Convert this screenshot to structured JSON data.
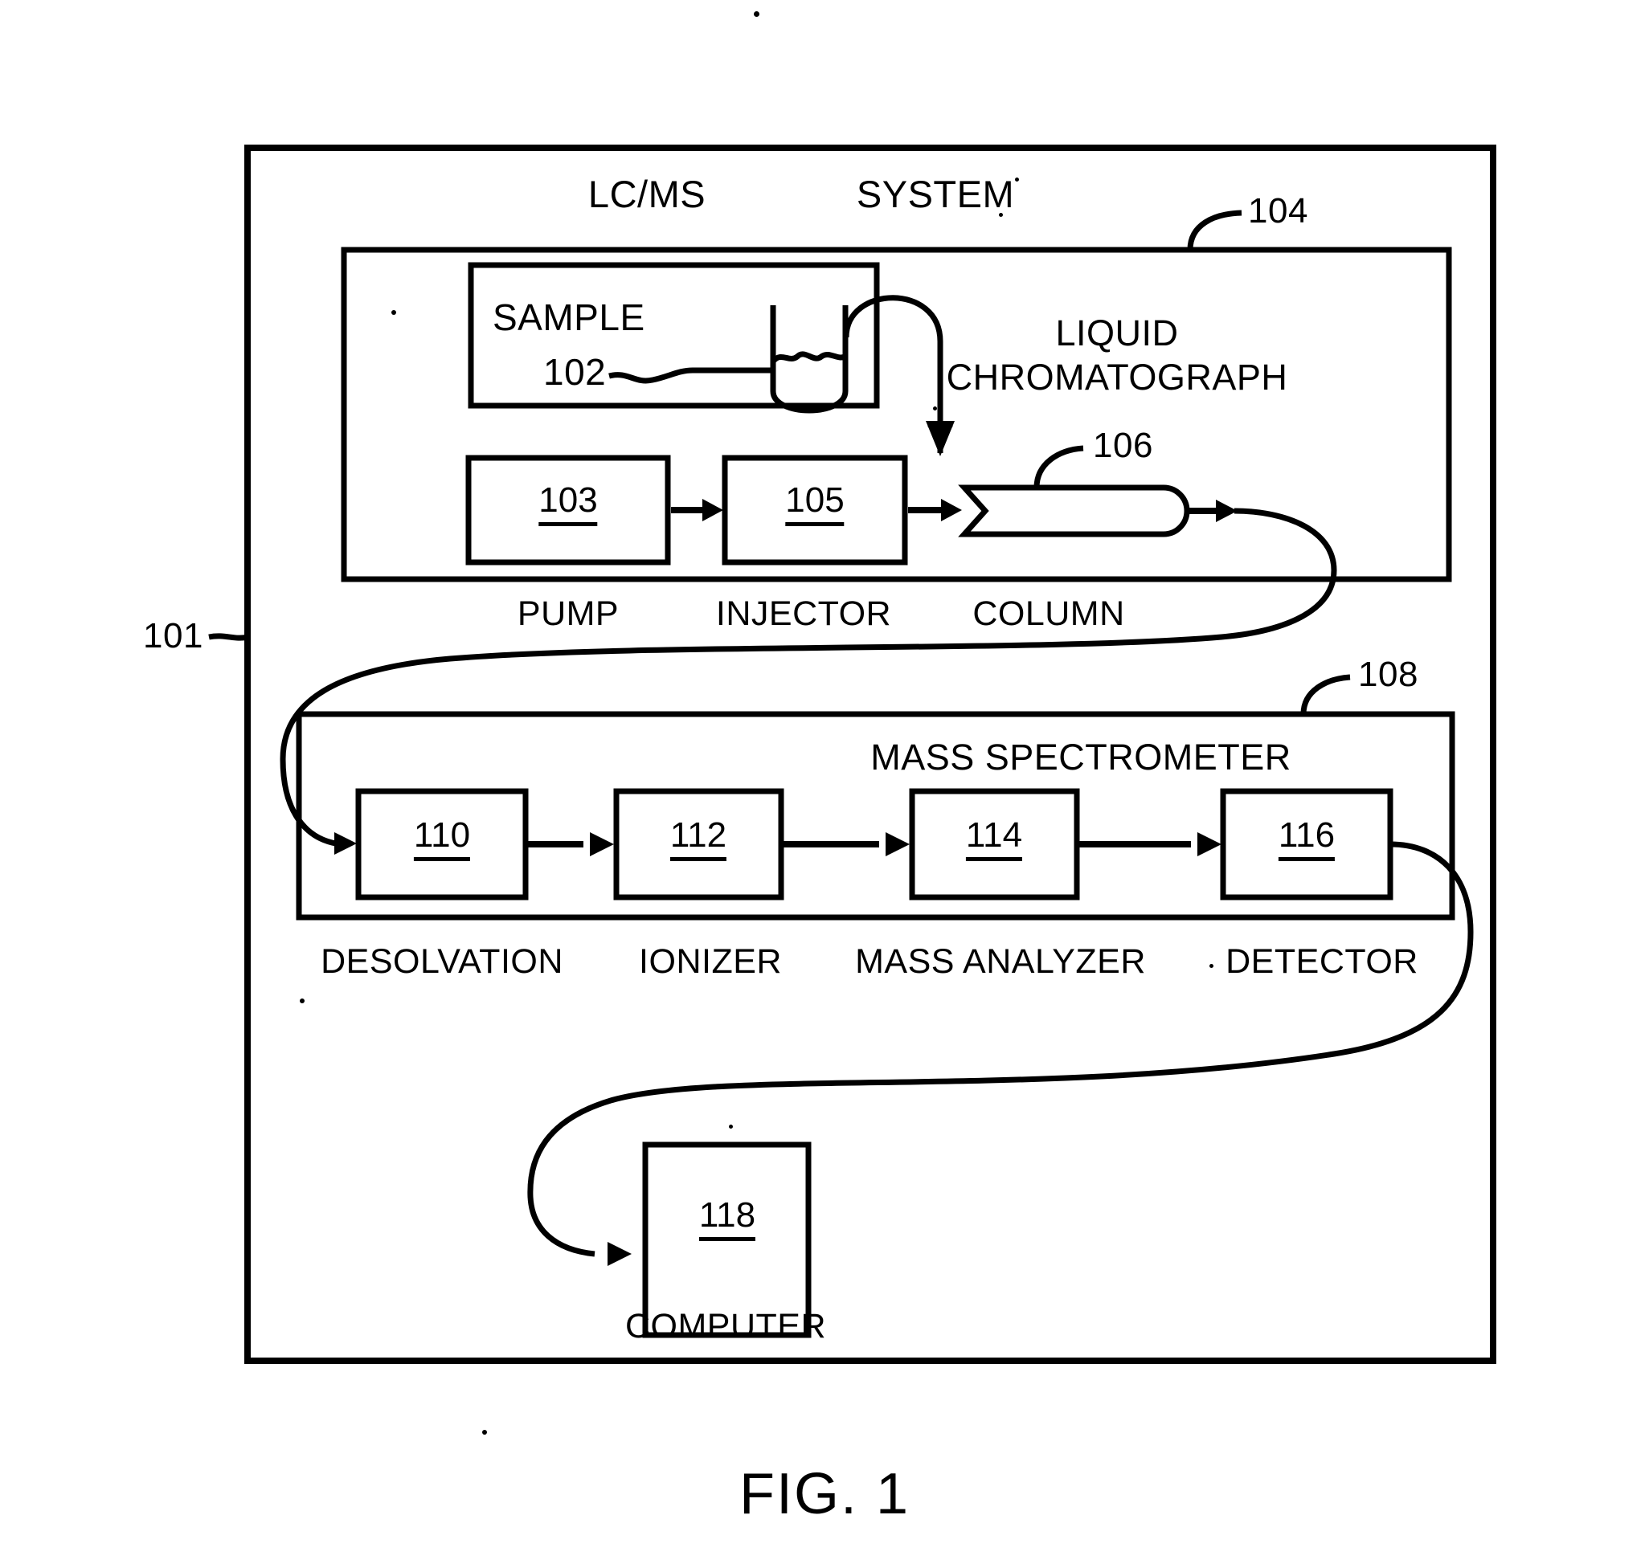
{
  "figure": {
    "caption": "FIG. 1",
    "title_left": "LC/MS",
    "title_right": "SYSTEM",
    "system_ref": "101"
  },
  "liquid_chromatograph": {
    "name": "LIQUID",
    "name_line2": "CHROMATOGRAPH",
    "ref": "104",
    "sample": {
      "label": "SAMPLE",
      "ref": "102"
    },
    "components": [
      {
        "ref": "103",
        "label": "PUMP"
      },
      {
        "ref": "105",
        "label": "INJECTOR"
      },
      {
        "ref": "106",
        "label": "COLUMN"
      }
    ]
  },
  "mass_spectrometer": {
    "name": "MASS SPECTROMETER",
    "ref": "108",
    "components": [
      {
        "ref": "110",
        "label": "DESOLVATION"
      },
      {
        "ref": "112",
        "label": "IONIZER"
      },
      {
        "ref": "114",
        "label": "MASS ANALYZER"
      },
      {
        "ref": "116",
        "label": "DETECTOR"
      }
    ]
  },
  "computer": {
    "ref": "118",
    "label": "COMPUTER"
  }
}
